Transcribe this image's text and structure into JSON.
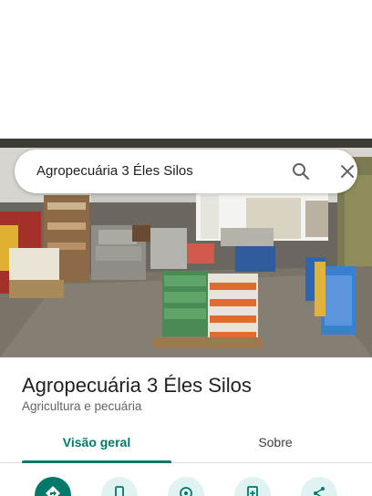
{
  "search": {
    "query": "Agropecuária 3 Éles Silos"
  },
  "place": {
    "name": "Agropecuária 3 Éles Silos",
    "category": "Agricultura e pecuária"
  },
  "tabs": [
    {
      "label": "Visão geral",
      "active": true
    },
    {
      "label": "Sobre",
      "active": false
    }
  ],
  "actions": [
    {
      "icon": "directions-icon",
      "primary": true
    },
    {
      "icon": "phone-icon",
      "primary": false
    },
    {
      "icon": "location-icon",
      "primary": false
    },
    {
      "icon": "save-icon",
      "primary": false
    },
    {
      "icon": "share-icon",
      "primary": false
    }
  ],
  "colors": {
    "accent": "#00796b",
    "action_bg": "#e0f2f1",
    "title_text": "#202124",
    "secondary_text": "#5f6368"
  }
}
